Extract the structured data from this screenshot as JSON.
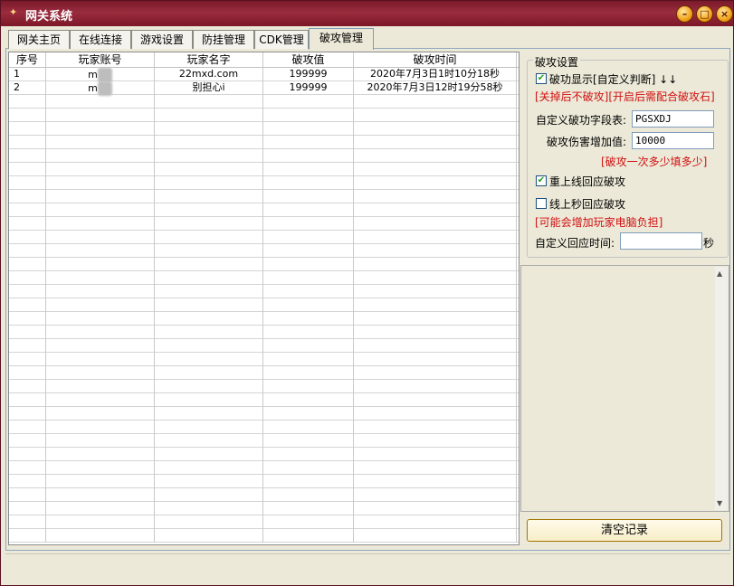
{
  "window": {
    "title": "网关系统"
  },
  "tabs": [
    {
      "label": "网关主页"
    },
    {
      "label": "在线连接"
    },
    {
      "label": "游戏设置"
    },
    {
      "label": "防挂管理"
    },
    {
      "label": "CDK管理"
    },
    {
      "label": "破攻管理",
      "active": true
    }
  ],
  "table": {
    "headers": [
      "序号",
      "玩家账号",
      "玩家名字",
      "破攻值",
      "破攻时间"
    ],
    "rows": [
      [
        "1",
        "m",
        "22mxd.com",
        "199999",
        "2020年7月3日1时10分18秒"
      ],
      [
        "2",
        "m",
        "别担心i",
        "199999",
        "2020年7月3日12时19分58秒"
      ]
    ]
  },
  "settings": {
    "legend": "破攻设置",
    "show_label": "破功显示[自定义判断] ↓↓",
    "show_checked": true,
    "warn1": "[关掉后不破攻][开启后需配合破攻石]",
    "custom_field_label": "自定义破功字段表:",
    "custom_field_value": "PGSXDJ",
    "damage_label": "破攻伤害增加值:",
    "damage_value": "10000",
    "damage_note": "[破攻一次多少填多少]",
    "reconnect_label": "重上线回应破攻",
    "reconnect_checked": true,
    "online_sec_label": "线上秒回应破攻",
    "online_sec_checked": false,
    "warn2": "[可能会增加玩家电脑负担]",
    "custom_time_label": "自定义回应时间:",
    "custom_time_value": "",
    "custom_time_unit": "秒"
  },
  "clear_button": "清空记录"
}
